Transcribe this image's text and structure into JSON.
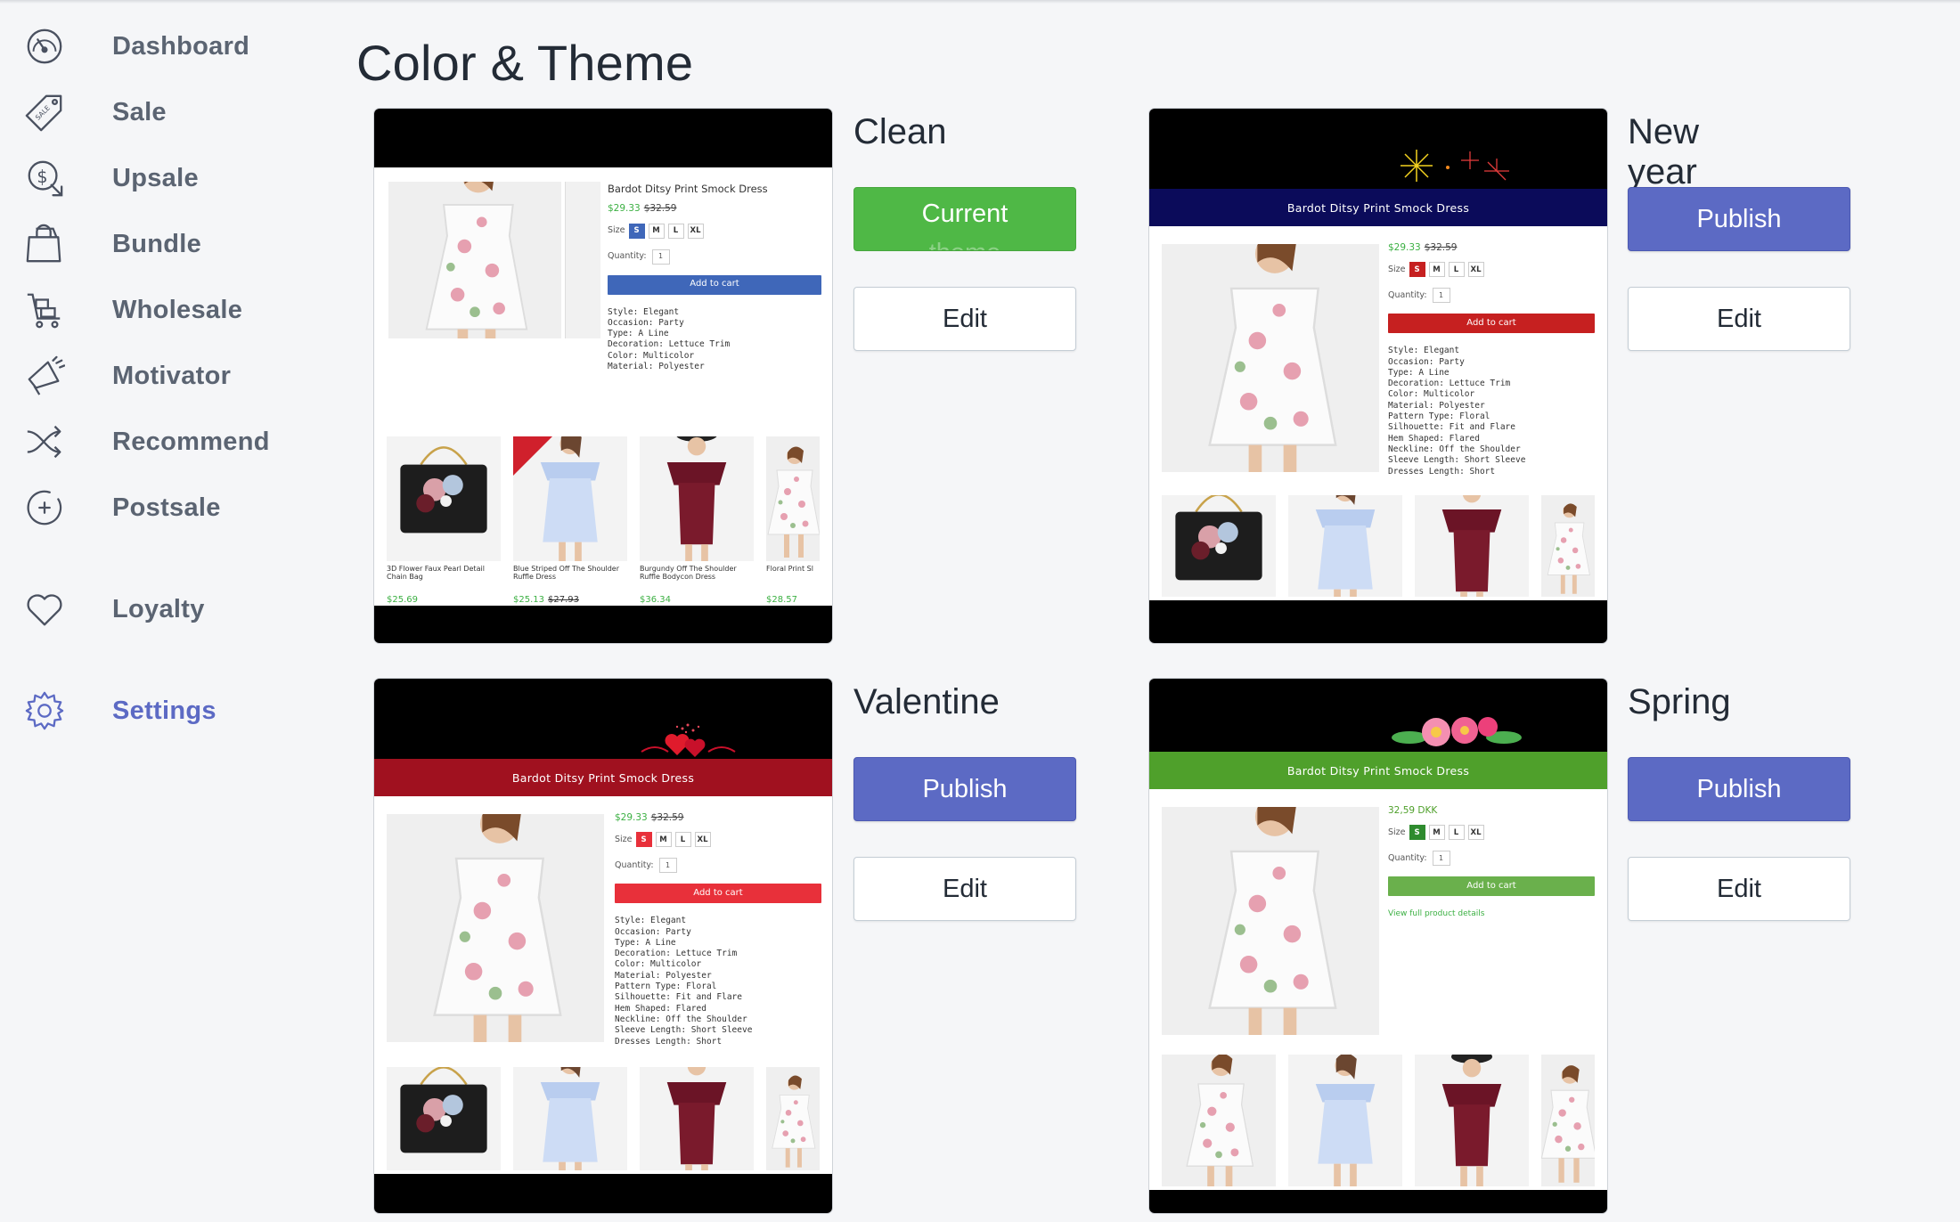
{
  "sidebar": {
    "items": [
      {
        "label": "Dashboard",
        "icon": "dashboard-gauge-icon"
      },
      {
        "label": "Sale",
        "icon": "sale-tag-icon"
      },
      {
        "label": "Upsale",
        "icon": "upsale-coin-icon"
      },
      {
        "label": "Bundle",
        "icon": "bundle-bag-icon"
      },
      {
        "label": "Wholesale",
        "icon": "wholesale-cart-icon"
      },
      {
        "label": "Motivator",
        "icon": "megaphone-icon"
      },
      {
        "label": "Recommend",
        "icon": "shuffle-icon"
      },
      {
        "label": "Postsale",
        "icon": "plus-circle-icon"
      },
      {
        "label": "Loyalty",
        "icon": "heart-icon"
      },
      {
        "label": "Settings",
        "icon": "gear-icon",
        "active": true
      }
    ]
  },
  "page": {
    "title": "Color & Theme"
  },
  "themes": [
    {
      "name": "Clean",
      "primary_button": "Current",
      "primary_sub": "theme",
      "edit_label": "Edit",
      "accent": "#3f67b9"
    },
    {
      "name": "New year",
      "primary_button": "Publish",
      "edit_label": "Edit",
      "accent": "#c62020"
    },
    {
      "name": "Valentine",
      "primary_button": "Publish",
      "edit_label": "Edit",
      "accent": "#e8303a"
    },
    {
      "name": "Spring",
      "primary_button": "Publish",
      "edit_label": "Edit",
      "accent": "#4fa02b"
    }
  ],
  "preview": {
    "product_title": "Bardot Ditsy Print Smock Dress",
    "price": "$29.33",
    "old_price": "$32.59",
    "price_dkk": "32,59 DKK",
    "size_label": "Size",
    "sizes": [
      "S",
      "M",
      "L",
      "XL"
    ],
    "quantity_label": "Quantity:",
    "quantity_value": "1",
    "add_to_cart": "Add to cart",
    "view_details": "View full product details",
    "details_short": [
      "Style: Elegant",
      "Occasion: Party",
      "Type: A Line",
      "Decoration: Lettuce Trim",
      "Color: Multicolor",
      "Material: Polyester"
    ],
    "details_long": [
      "Style: Elegant",
      "Occasion: Party",
      "Type: A Line",
      "Decoration: Lettuce Trim",
      "Color: Multicolor",
      "Material: Polyester",
      "Pattern Type: Floral",
      "Silhouette: Fit and Flare",
      "Hem Shaped: Flared",
      "Neckline: Off the Shoulder",
      "Sleeve Length: Short Sleeve",
      "Dresses Length: Short"
    ],
    "related": [
      {
        "caption": "3D Flower Faux Pearl Detail Chain Bag",
        "price": "$25.69",
        "old": ""
      },
      {
        "caption": "Blue Striped Off The Shoulder Ruffle Dress",
        "price": "$25.13",
        "old": "$27.93"
      },
      {
        "caption": "Burgundy Off The Shoulder Ruffle Bodycon Dress",
        "price": "$36.34",
        "old": ""
      },
      {
        "caption": "Floral Print Sl",
        "price": "$28.57",
        "old": ""
      }
    ]
  },
  "colors": {
    "publish": "#5c6ac4",
    "current": "#4fb846",
    "newyear_banner": "#0b0b5a",
    "valentine_banner": "#a0111f",
    "spring_banner": "#4fa02b"
  }
}
